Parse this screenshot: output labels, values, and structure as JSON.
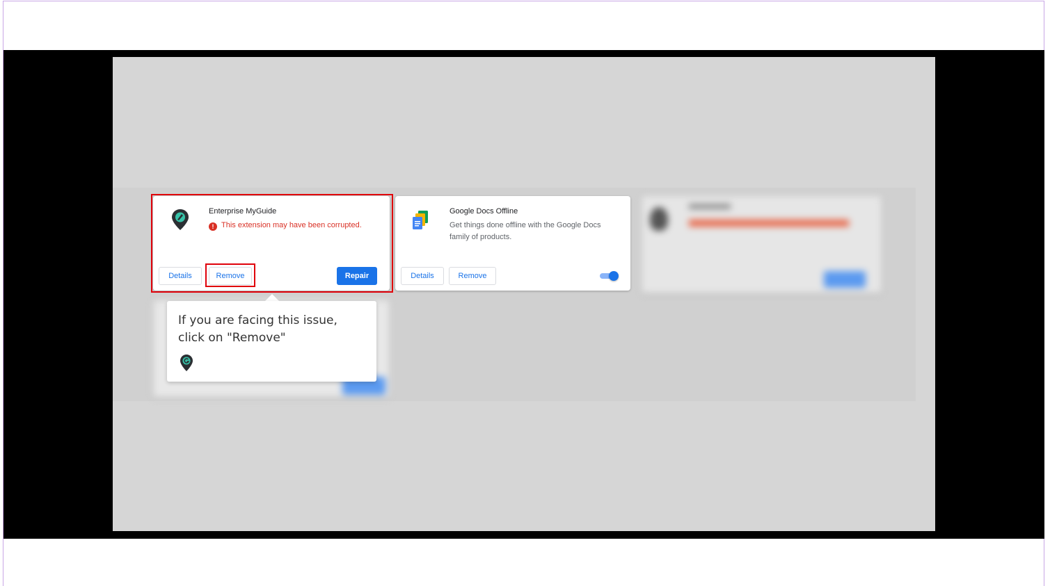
{
  "colors": {
    "accent": "#1a73e8",
    "error": "#d93025",
    "highlight": "#e0000a"
  },
  "card_myguide": {
    "title": "Enterprise MyGuide",
    "icon": "myguide-logo-icon",
    "error_icon": "error-icon",
    "error_glyph": "!",
    "error_text": "This extension may have been corrupted.",
    "details_label": "Details",
    "remove_label": "Remove",
    "repair_label": "Repair"
  },
  "card_docs": {
    "title": "Google Docs Offline",
    "icon": "google-docs-icon",
    "description": "Get things done offline with the Google Docs family of products.",
    "details_label": "Details",
    "remove_label": "Remove",
    "enabled": true
  },
  "tooltip": {
    "text": "If you are facing this issue, click on \"Remove\"",
    "logo_icon": "myguide-logo-icon"
  }
}
